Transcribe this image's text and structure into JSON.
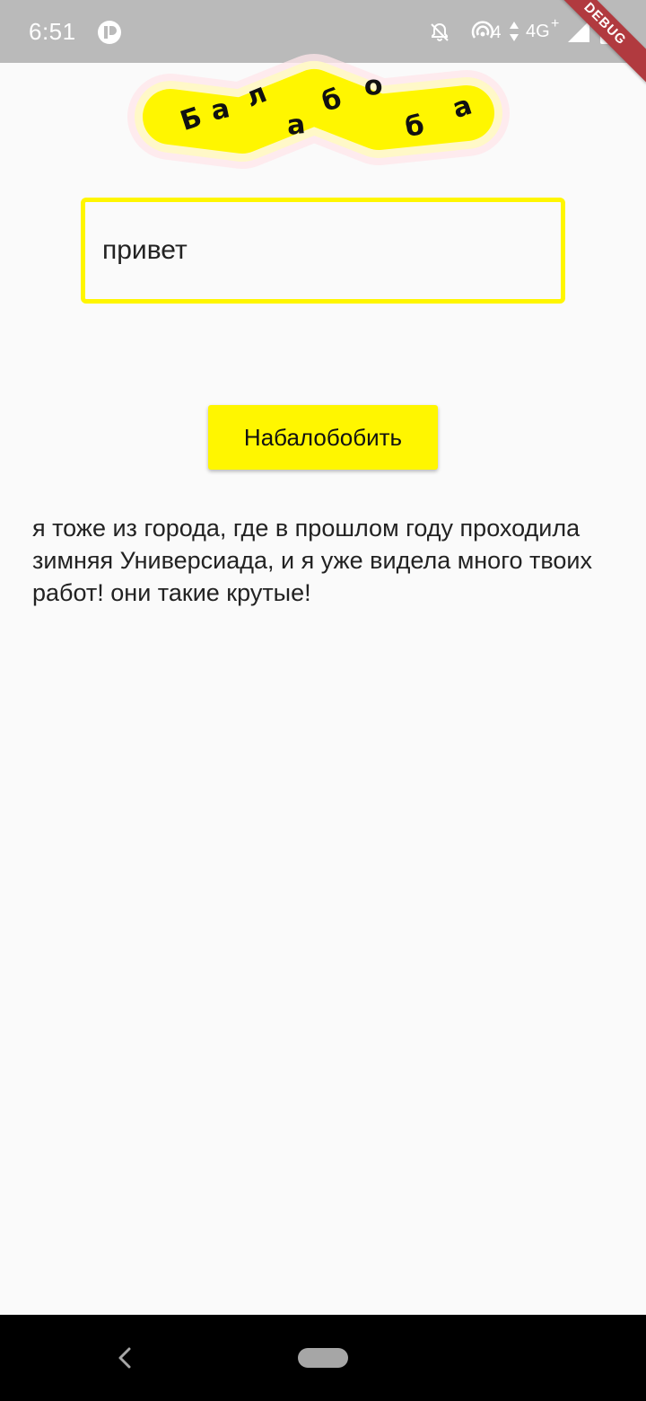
{
  "status_bar": {
    "time": "6:51",
    "network": "4G",
    "icons": [
      "app-notification-icon",
      "alarm-off-icon",
      "hotspot-icon",
      "data-arrows-icon",
      "cell-signal-icon",
      "battery-charging-icon"
    ],
    "debug_label": "DEBUG"
  },
  "logo": {
    "text": "Балабоба",
    "letters": [
      "Б",
      "а",
      "л",
      "а",
      "б",
      "о",
      "б",
      "а"
    ],
    "colors": {
      "fill": "#fff600",
      "halo": "#ffe4e4"
    }
  },
  "input": {
    "value": "привет"
  },
  "generate_button": {
    "label": "Набалобобить"
  },
  "result": {
    "text": "я тоже из города, где в прошлом году проходила зимняя Универсиада, и я уже видела много твоих работ! они такие крутые!"
  },
  "nav_bar": {
    "icons": [
      "back-icon",
      "home-pill-icon"
    ]
  },
  "colors": {
    "accent_yellow": "#fff600",
    "background": "#fafafa",
    "status_bar": "#bababa",
    "debug_banner": "#b13a3f"
  }
}
